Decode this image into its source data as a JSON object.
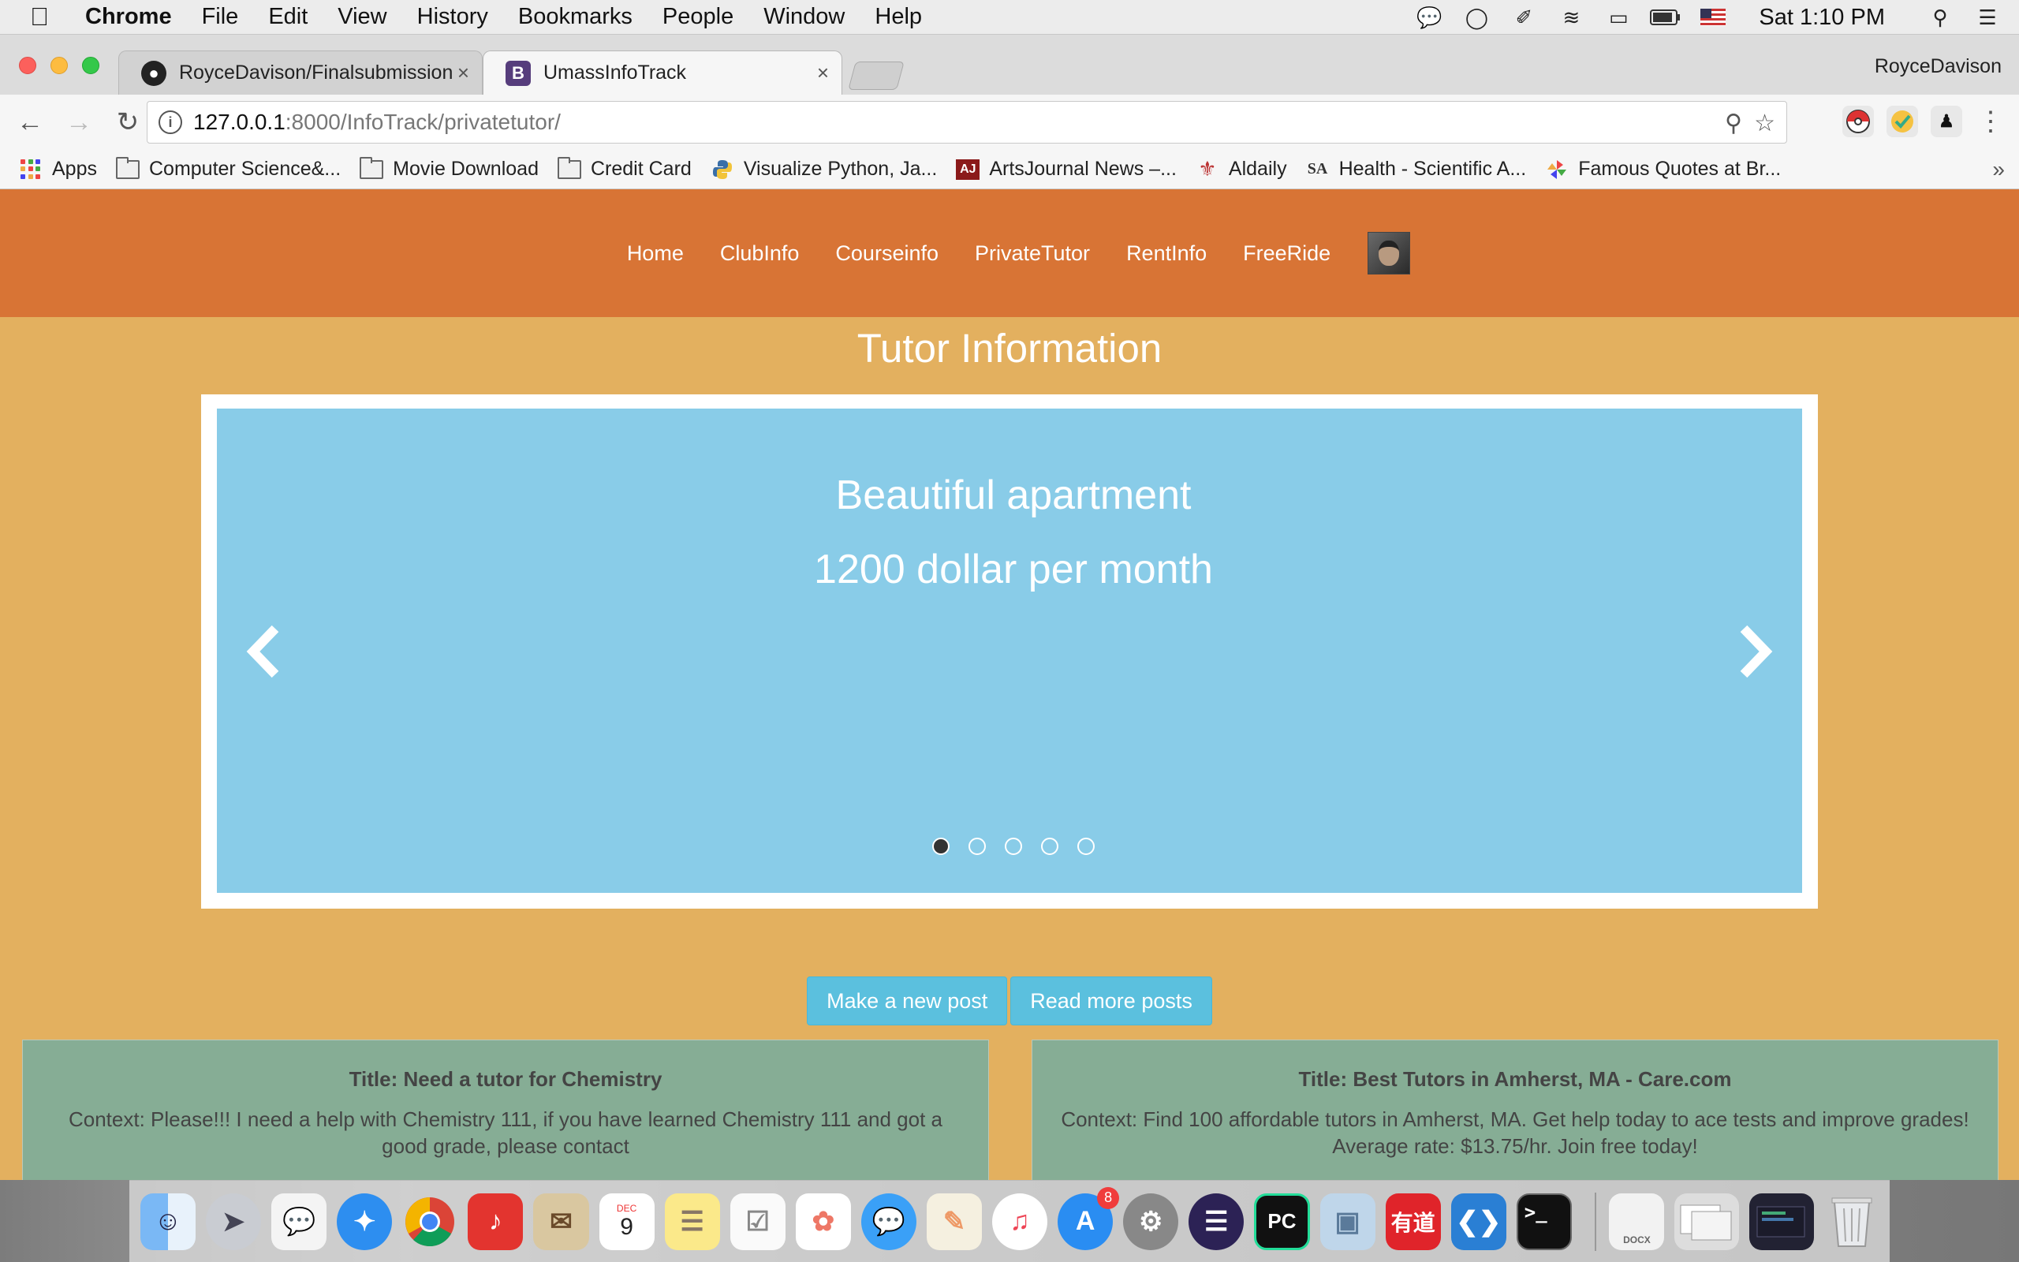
{
  "menubar": {
    "app_name": "Chrome",
    "items": [
      "File",
      "Edit",
      "View",
      "History",
      "Bookmarks",
      "People",
      "Window",
      "Help"
    ],
    "clock": "Sat 1:10 PM"
  },
  "tabs": [
    {
      "title": "RoyceDavison/Finalsubmission",
      "icon": "github-icon"
    },
    {
      "title": "UmassInfoTrack",
      "icon": "bootstrap-icon",
      "favicon_letter": "B"
    }
  ],
  "profile_name": "RoyceDavison",
  "address": {
    "host": "127.0.0.1",
    "rest": ":8000/InfoTrack/privatetutor/"
  },
  "bookmarks": [
    {
      "label": "Apps",
      "icon": "apps-grid-icon"
    },
    {
      "label": "Computer Science&...",
      "icon": "folder-icon"
    },
    {
      "label": "Movie Download",
      "icon": "folder-icon"
    },
    {
      "label": "Credit Card",
      "icon": "folder-icon"
    },
    {
      "label": "Visualize Python, Ja...",
      "icon": "python-icon"
    },
    {
      "label": "ArtsJournal News –...",
      "icon": "artsjournal-icon",
      "icon_text": "AJ"
    },
    {
      "label": "Aldaily",
      "icon": "aldaily-icon"
    },
    {
      "label": "Health - Scientific A...",
      "icon": "scientific-american-icon",
      "icon_text": "SA"
    },
    {
      "label": "Famous Quotes at Br...",
      "icon": "pinwheel-icon"
    }
  ],
  "nav": {
    "links": [
      "Home",
      "ClubInfo",
      "Courseinfo",
      "PrivateTutor",
      "RentInfo",
      "FreeRide"
    ]
  },
  "page": {
    "title": "Tutor Information",
    "carousel": {
      "line1": "Beautiful apartment",
      "line2": "1200 dollar per month",
      "slides_total": 5,
      "active_slide": 1
    },
    "buttons": {
      "new_post": "Make a new post",
      "more_posts": "Read more posts"
    },
    "cards": [
      {
        "title": "Title: Need a tutor for Chemistry",
        "context": "Context: Please!!! I need a help with Chemistry 111, if you have learned Chemistry 111 and got a good grade, please contact"
      },
      {
        "title": "Title: Best Tutors in Amherst, MA - Care.com",
        "context": "Context: Find 100 affordable tutors in Amherst, MA. Get help today to ace tests and improve grades! Average rate: $13.75/hr. Join free today!"
      }
    ]
  },
  "dock": {
    "calendar_month": "DEC",
    "calendar_day": "9",
    "app_store_badge": "8",
    "youdao_text": "有道",
    "pycharm_text": "PC",
    "terminal_text": ">_",
    "docx_text": "DOCX"
  },
  "colors": {
    "page_bg": "#e3b05f",
    "navbar_bg": "#d87435",
    "carousel_bg": "#89cce8",
    "card_bg": "#86ad95",
    "button_bg": "#5bc0de"
  }
}
